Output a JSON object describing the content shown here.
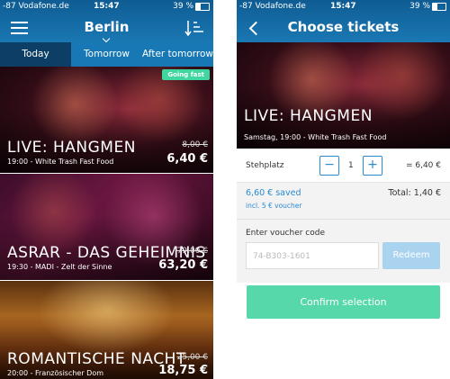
{
  "status_left": {
    "carrier": "-87 Vodafone.de",
    "time": "15:47",
    "battery": "39 %"
  },
  "status_right": {
    "carrier": "-87 Vodafone.de",
    "time": "15:47",
    "battery": "39 %"
  },
  "left": {
    "city": "Berlin",
    "tabs": [
      "Today",
      "Tomorrow",
      "After tomorrow"
    ],
    "events": [
      {
        "title": "LIVE: HANGMEN",
        "meta": "19:00 - White Trash Fast Food",
        "old_price": "8,00 €",
        "price": "6,40 €",
        "badge": "Going fast"
      },
      {
        "title": "ASRAR - DAS GEHEIMNIS",
        "meta": "19:30 - MADI - Zelt der Sinne",
        "old_price": "79,00 €",
        "price": "63,20 €"
      },
      {
        "title": "ROMANTISCHE NACHT",
        "meta": "20:00 - Französischer Dom",
        "old_price": "25,00 €",
        "price": "18,75 €"
      }
    ]
  },
  "right": {
    "title": "Choose tickets",
    "event": {
      "title": "LIVE: HANGMEN",
      "meta": "Samstag, 19:00 - White Trash Fast Food"
    },
    "ticket": {
      "type": "Stehplatz",
      "qty": "1",
      "line_price": "= 6,40 €"
    },
    "saved": {
      "amount": "6,60 € saved",
      "voucher": "incl. 5 € voucher",
      "total": "Total: 1,40 €"
    },
    "voucher": {
      "label": "Enter voucher code",
      "placeholder": "74-B303-1601",
      "redeem": "Redeem"
    },
    "confirm": "Confirm selection"
  }
}
